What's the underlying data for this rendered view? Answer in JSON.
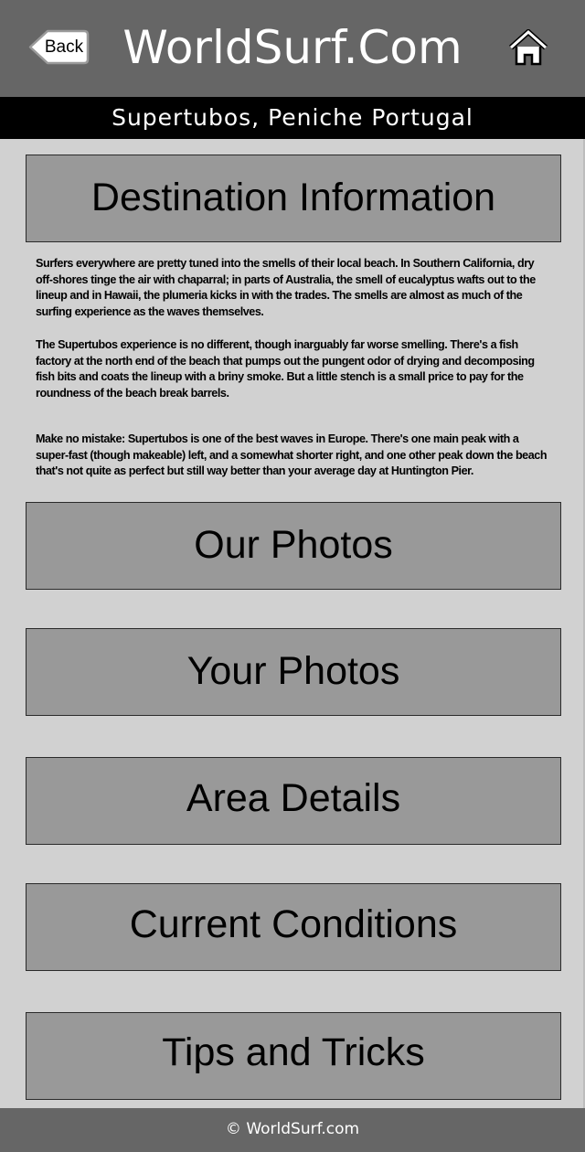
{
  "header": {
    "back_label": "Back",
    "title": "WorldSurf.Com",
    "home_icon": "home-icon"
  },
  "location": {
    "name": "Supertubos, Peniche Portugal"
  },
  "destination": {
    "button_label": "Destination Information",
    "paragraphs": [
      "Surfers everywhere are pretty tuned into the smells of their local beach. In Southern California, dry off-shores tinge the air with chaparral; in parts of Australia,  the smell of eucalyptus wafts out to the lineup and in Hawaii, the plumeria kicks in with the trades. The smells are almost as much of the surfing experience as the waves themselves.",
      "The Supertubos experience is no different, though inarguably far worse smelling. There's a fish factory at the north end of the beach that pumps out the pungent odor of drying and decomposing fish bits and coats the lineup with a briny smoke. But a little stench is a small price to pay for the roundness of the beach break barrels.",
      "Make no mistake: Supertubos is one of the best waves in Europe. There's one main peak with a super-fast (though makeable) left, and a somewhat shorter right, and one other peak down the beach that's not quite as perfect but still way better than your average day at Huntington Pier."
    ]
  },
  "sections": {
    "our_photos": "Our Photos",
    "your_photos": "Your Photos",
    "area_details": "Area Details",
    "current_conditions": "Current Conditions",
    "tips_and_tricks": "Tips and Tricks"
  },
  "footer": {
    "copyright": "© WorldSurf.com"
  },
  "colors": {
    "header_bg": "#666666",
    "location_bar_bg": "#000000",
    "content_bg": "#d1d1d1",
    "button_bg": "#999999"
  }
}
